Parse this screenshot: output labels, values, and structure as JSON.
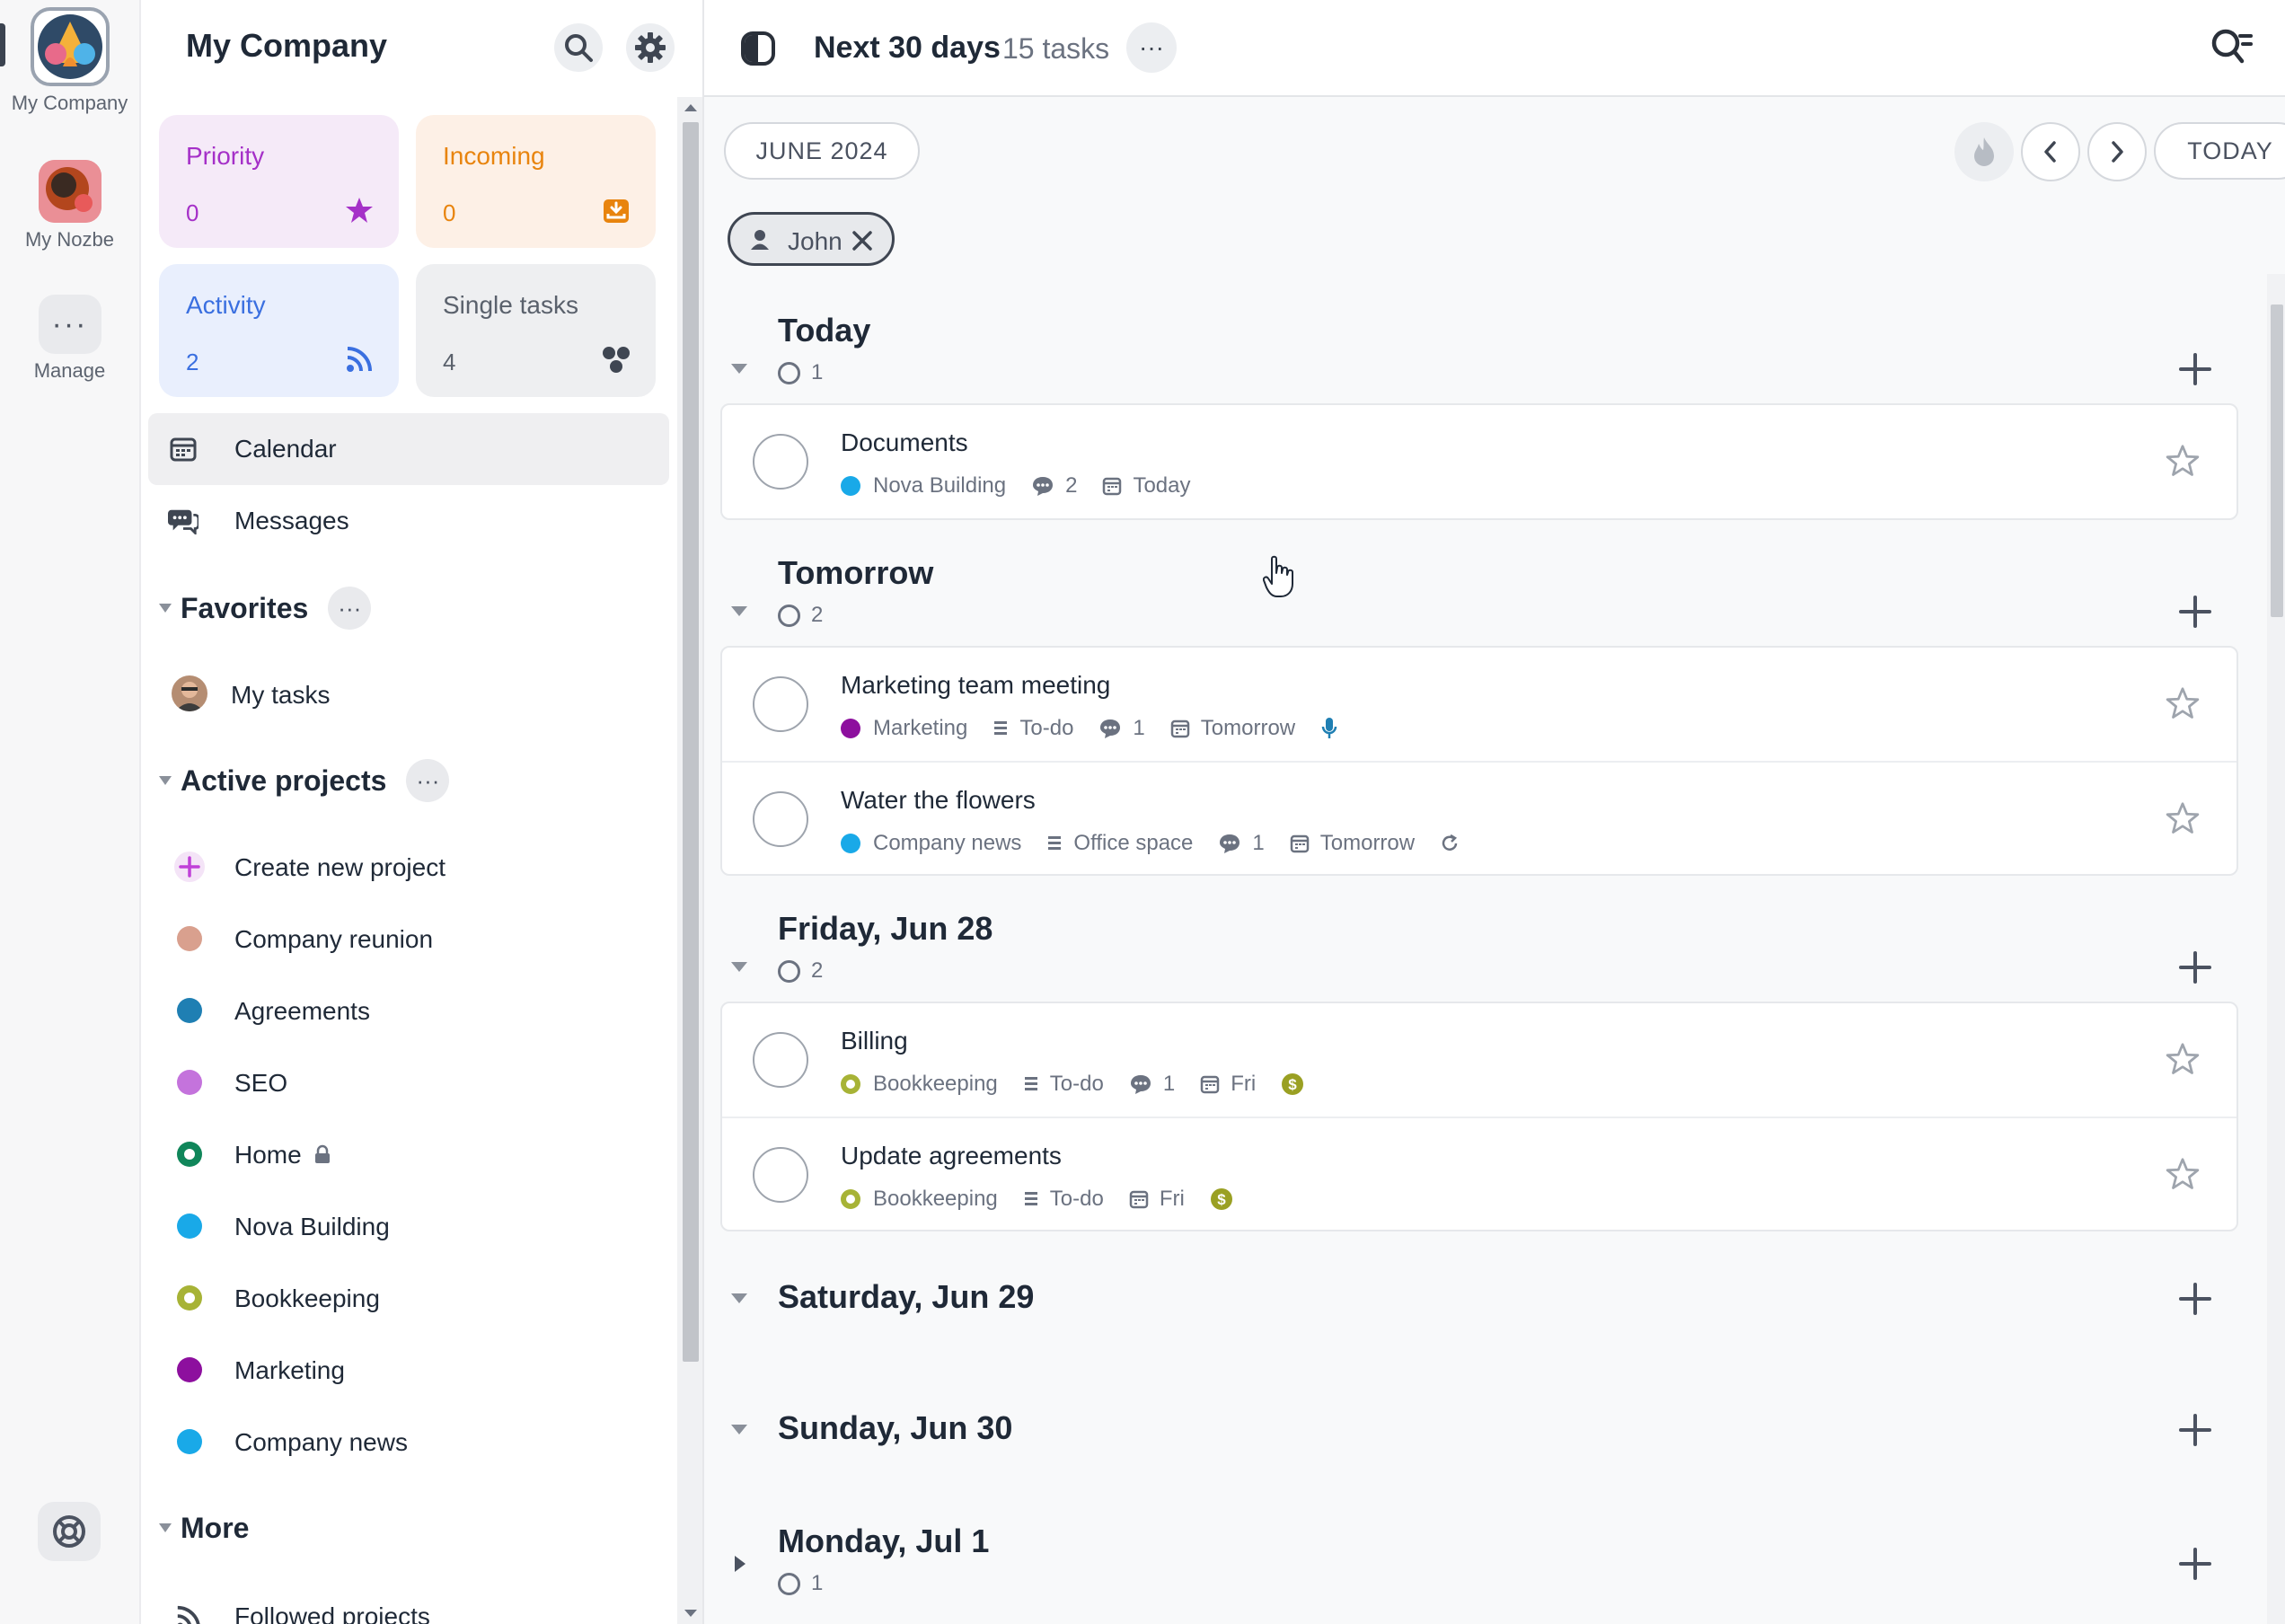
{
  "rail": {
    "workspace_label": "My Company",
    "nozbe_label": "My Nozbe",
    "manage_label": "Manage",
    "manage_glyph": "···"
  },
  "sidebar": {
    "title": "My Company",
    "tiles": [
      {
        "label": "Priority",
        "count": "0",
        "icon": "star-icon",
        "bg": "#f5eaf8",
        "fg": "#a530c8"
      },
      {
        "label": "Incoming",
        "count": "0",
        "icon": "inbox-download-icon",
        "bg": "#fdf0e6",
        "fg": "#e8840e"
      },
      {
        "label": "Activity",
        "count": "2",
        "icon": "rss-feed-icon",
        "bg": "#e9effd",
        "fg": "#3a6fe0"
      },
      {
        "label": "Single tasks",
        "count": "4",
        "icon": "cluster-dots-icon",
        "bg": "#eeeff1",
        "fg": "#5a616c"
      }
    ],
    "nav": [
      {
        "label": "Calendar",
        "icon": "calendar-icon",
        "active": true
      },
      {
        "label": "Messages",
        "icon": "chat-bubbles-icon",
        "active": false
      }
    ],
    "favorites": {
      "label": "Favorites",
      "more": "···",
      "items": [
        {
          "label": "My tasks"
        }
      ]
    },
    "active_projects": {
      "label": "Active projects",
      "more": "···",
      "create_label": "Create new project",
      "items": [
        {
          "label": "Company reunion",
          "color": "#d9a08e",
          "style": "dot"
        },
        {
          "label": "Agreements",
          "color": "#1f7fb3",
          "style": "dot"
        },
        {
          "label": "SEO",
          "color": "#c473dc",
          "style": "dot"
        },
        {
          "label": "Home",
          "color": "#10865a",
          "style": "ring",
          "locked": true
        },
        {
          "label": "Nova Building",
          "color": "#19a9e8",
          "style": "dot"
        },
        {
          "label": "Bookkeeping",
          "color": "#a7b336",
          "style": "ring"
        },
        {
          "label": "Marketing",
          "color": "#8d0f9e",
          "style": "dot"
        },
        {
          "label": "Company news",
          "color": "#19a9e8",
          "style": "dot"
        }
      ]
    },
    "more_section": {
      "label": "More",
      "items": [
        {
          "label": "Followed projects"
        }
      ]
    }
  },
  "topbar": {
    "title": "Next 30 days",
    "count": "15 tasks",
    "more": "···"
  },
  "subbar": {
    "month_label": "JUNE 2024",
    "today_label": "TODAY"
  },
  "filter": {
    "user": "John"
  },
  "days": [
    {
      "title": "Today",
      "count": "1",
      "expanded": true,
      "tasks": [
        {
          "name": "Documents",
          "project": "Nova Building",
          "project_color": "#19a9e8",
          "project_style": "dot",
          "comments": "2",
          "date": "Today"
        }
      ]
    },
    {
      "title": "Tomorrow",
      "count": "2",
      "expanded": true,
      "tasks": [
        {
          "name": "Marketing team meeting",
          "project": "Marketing",
          "project_color": "#8d0f9e",
          "project_style": "dot",
          "section": "To-do",
          "comments": "1",
          "date": "Tomorrow",
          "extra_icon": "microphone-icon"
        },
        {
          "name": "Water the flowers",
          "project": "Company news",
          "project_color": "#19a9e8",
          "project_style": "dot",
          "section": "Office space",
          "comments": "1",
          "date": "Tomorrow",
          "extra_icon": "repeat-icon"
        }
      ]
    },
    {
      "title": "Friday, Jun 28",
      "count": "2",
      "expanded": true,
      "tasks": [
        {
          "name": "Billing",
          "project": "Bookkeeping",
          "project_color": "#a7b336",
          "project_style": "ring",
          "section": "To-do",
          "comments": "1",
          "date": "Fri",
          "extra_icon": "dollar-badge-icon"
        },
        {
          "name": "Update agreements",
          "project": "Bookkeeping",
          "project_color": "#a7b336",
          "project_style": "ring",
          "section": "To-do",
          "date": "Fri",
          "extra_icon": "dollar-badge-icon"
        }
      ]
    },
    {
      "title": "Saturday, Jun 29",
      "expanded": true,
      "tasks": []
    },
    {
      "title": "Sunday, Jun 30",
      "expanded": true,
      "tasks": []
    },
    {
      "title": "Monday, Jul 1",
      "count": "1",
      "expanded": false,
      "tasks": []
    }
  ],
  "colors": {
    "accent_dark": "#3f4652",
    "create_plus": "#c040d8",
    "dollar_badge": "#9aa023",
    "mic_blue": "#1f7fb3"
  }
}
